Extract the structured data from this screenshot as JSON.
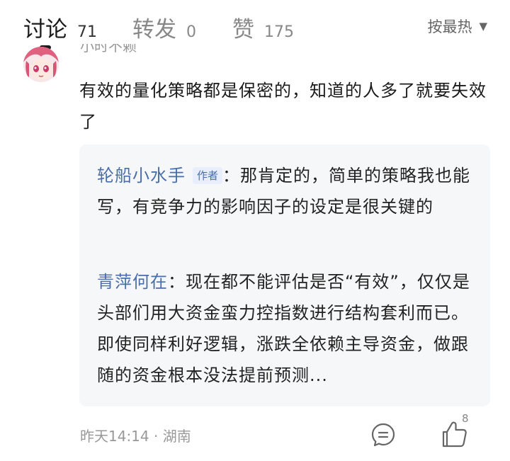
{
  "tabs": [
    {
      "label": "讨论",
      "count": "71"
    },
    {
      "label": "转发",
      "count": "0"
    },
    {
      "label": "赞",
      "count": "175"
    }
  ],
  "sort": {
    "label": "按最热"
  },
  "comment": {
    "username": "小时不赖",
    "text": "有效的量化策略都是保密的，知道的人多了就要失效了",
    "time_location": "昨天14:14 · 湖南",
    "like_count": "8"
  },
  "replies": [
    {
      "author": "轮船小水手",
      "badge": "作者",
      "text": "：那肯定的，简单的策略我也能写，有竞争力的影响因子的设定是很关键的"
    },
    {
      "author": "青萍何在",
      "text": "：现在都不能评估是否“有效”，仅仅是头部们用大资金蛮力控指数进行结构套利而已。即使同样利好逻辑，涨跌全依赖主导资金，做跟随的资金根本没法提前预测..."
    }
  ]
}
